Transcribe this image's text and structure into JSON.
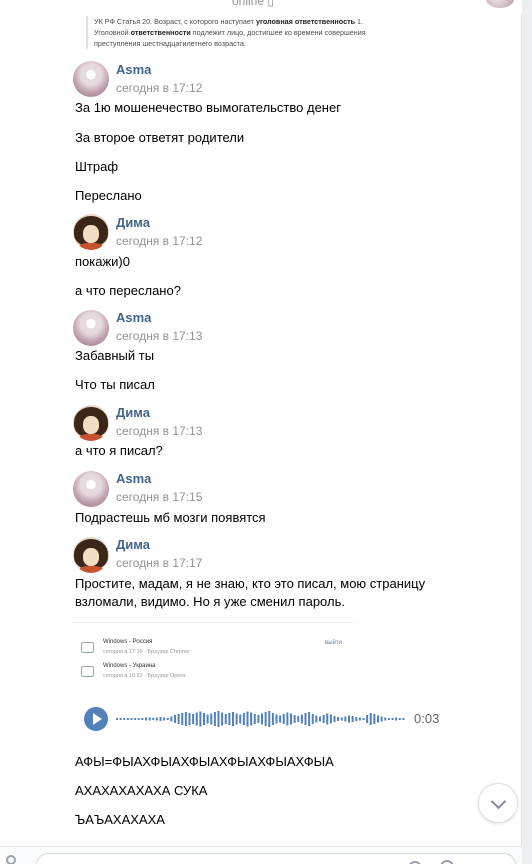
{
  "header": {
    "status": "online ▯"
  },
  "quote": {
    "line1_prefix": "УК РФ Статья 20. Возраст, с которого наступает ",
    "line1_bold": "уголовная ответственность",
    "line1_suffix": " 1.",
    "line2_prefix": "Уголовной ",
    "line2_bold": "ответственности",
    "line2_suffix": " подлежит лицо, достигшее ко времени совершения",
    "line3": "преступления шестнадцатилетнего возраста."
  },
  "messages": [
    {
      "author": "Asma",
      "time": "сегодня в 17:12",
      "lines": [
        "За 1ю мошенечество вымогательство денег",
        "За второе ответят родители",
        "Штраф",
        "Переслано"
      ]
    },
    {
      "author": "Дима",
      "time": "сегодня в 17:12",
      "lines": [
        "покажи)0",
        "а что переслано?"
      ]
    },
    {
      "author": "Asma",
      "time": "сегодня в 17:13",
      "lines": [
        "Забавный ты",
        "Что ты писал"
      ]
    },
    {
      "author": "Дима",
      "time": "сегодня в 17:13",
      "lines": [
        "а что я писал?"
      ]
    },
    {
      "author": "Asma",
      "time": "сегодня в 17:15",
      "lines": [
        "Подрастешь мб мозги появятся"
      ]
    },
    {
      "author": "Дима",
      "time": "сегодня в 17:17",
      "lines": [
        "Простите, мадам, я не знаю, кто это писал, мою страницу",
        "взломали, видимо. Но я уже сменил пароль."
      ]
    }
  ],
  "forwarded": {
    "rows": [
      {
        "title": "Windows - Россия",
        "sub": "сегодня в 17:16 · Браузер Chrome",
        "link": "выйти"
      },
      {
        "title": "Windows - Украина",
        "sub": "сегодня в 16:22 · Браузер Opera",
        "link": ""
      }
    ]
  },
  "voice": {
    "duration": "0:03",
    "progress": 0
  },
  "trailing_messages": [
    "АФЫ=ФЫАХФЫАХФЫАХФЫАХФЫАХФЫА",
    "АХАХАХАХАХА СУКА",
    "ЪАЪАХАХАХА"
  ],
  "colors": {
    "accent": "#5181b8",
    "author_name": "#42648b",
    "meta_text": "#939393"
  }
}
